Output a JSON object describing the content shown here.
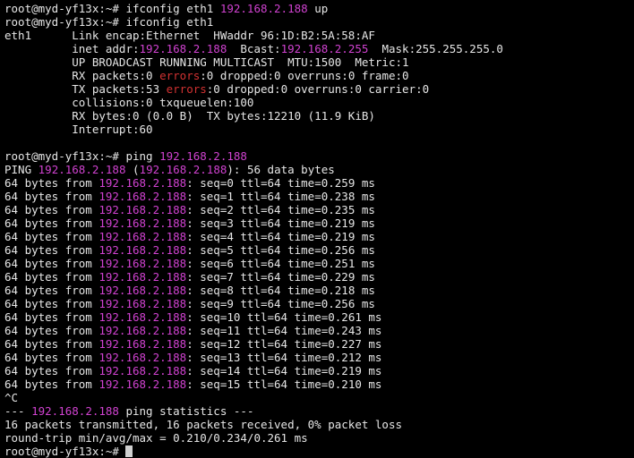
{
  "colors": {
    "background": "#000000",
    "text": "#e6e6e6",
    "ip_highlight": "#d042d0",
    "error_highlight": "#d23232"
  },
  "prompt": "root@myd-yf13x:~# ",
  "ip": "192.168.2.188",
  "lines": [
    [
      {
        "t": "root@myd-yf13x:~# ifconfig eth1 "
      },
      {
        "t": "192.168.2.188",
        "c": "mag"
      },
      {
        "t": " up"
      }
    ],
    [
      {
        "t": "root@myd-yf13x:~# ifconfig eth1"
      }
    ],
    [
      {
        "t": "eth1      Link encap:Ethernet  HWaddr 96:1D:B2:5A:58:AF"
      }
    ],
    [
      {
        "t": "          inet addr:"
      },
      {
        "t": "192.168.2.188",
        "c": "mag"
      },
      {
        "t": "  Bcast:"
      },
      {
        "t": "192.168.2.255",
        "c": "mag"
      },
      {
        "t": "  Mask:255.255.255.0"
      }
    ],
    [
      {
        "t": "          UP BROADCAST RUNNING MULTICAST  MTU:1500  Metric:1"
      }
    ],
    [
      {
        "t": "          RX packets:0 "
      },
      {
        "t": "errors",
        "c": "red"
      },
      {
        "t": ":0 dropped:0 overruns:0 frame:0"
      }
    ],
    [
      {
        "t": "          TX packets:53 "
      },
      {
        "t": "errors",
        "c": "red"
      },
      {
        "t": ":0 dropped:0 overruns:0 carrier:0"
      }
    ],
    [
      {
        "t": "          collisions:0 txqueuelen:100"
      }
    ],
    [
      {
        "t": "          RX bytes:0 (0.0 B)  TX bytes:12210 (11.9 KiB)"
      }
    ],
    [
      {
        "t": "          Interrupt:60"
      }
    ],
    [
      {
        "t": ""
      }
    ],
    [
      {
        "t": "root@myd-yf13x:~# ping "
      },
      {
        "t": "192.168.2.188",
        "c": "mag"
      }
    ],
    [
      {
        "t": "PING "
      },
      {
        "t": "192.168.2.188",
        "c": "mag"
      },
      {
        "t": " ("
      },
      {
        "t": "192.168.2.188",
        "c": "mag"
      },
      {
        "t": "): 56 data bytes"
      }
    ],
    [
      {
        "t": "64 bytes from "
      },
      {
        "t": "192.168.2.188",
        "c": "mag"
      },
      {
        "t": ": seq=0 ttl=64 time=0.259 ms"
      }
    ],
    [
      {
        "t": "64 bytes from "
      },
      {
        "t": "192.168.2.188",
        "c": "mag"
      },
      {
        "t": ": seq=1 ttl=64 time=0.238 ms"
      }
    ],
    [
      {
        "t": "64 bytes from "
      },
      {
        "t": "192.168.2.188",
        "c": "mag"
      },
      {
        "t": ": seq=2 ttl=64 time=0.235 ms"
      }
    ],
    [
      {
        "t": "64 bytes from "
      },
      {
        "t": "192.168.2.188",
        "c": "mag"
      },
      {
        "t": ": seq=3 ttl=64 time=0.219 ms"
      }
    ],
    [
      {
        "t": "64 bytes from "
      },
      {
        "t": "192.168.2.188",
        "c": "mag"
      },
      {
        "t": ": seq=4 ttl=64 time=0.219 ms"
      }
    ],
    [
      {
        "t": "64 bytes from "
      },
      {
        "t": "192.168.2.188",
        "c": "mag"
      },
      {
        "t": ": seq=5 ttl=64 time=0.256 ms"
      }
    ],
    [
      {
        "t": "64 bytes from "
      },
      {
        "t": "192.168.2.188",
        "c": "mag"
      },
      {
        "t": ": seq=6 ttl=64 time=0.251 ms"
      }
    ],
    [
      {
        "t": "64 bytes from "
      },
      {
        "t": "192.168.2.188",
        "c": "mag"
      },
      {
        "t": ": seq=7 ttl=64 time=0.229 ms"
      }
    ],
    [
      {
        "t": "64 bytes from "
      },
      {
        "t": "192.168.2.188",
        "c": "mag"
      },
      {
        "t": ": seq=8 ttl=64 time=0.218 ms"
      }
    ],
    [
      {
        "t": "64 bytes from "
      },
      {
        "t": "192.168.2.188",
        "c": "mag"
      },
      {
        "t": ": seq=9 ttl=64 time=0.256 ms"
      }
    ],
    [
      {
        "t": "64 bytes from "
      },
      {
        "t": "192.168.2.188",
        "c": "mag"
      },
      {
        "t": ": seq=10 ttl=64 time=0.261 ms"
      }
    ],
    [
      {
        "t": "64 bytes from "
      },
      {
        "t": "192.168.2.188",
        "c": "mag"
      },
      {
        "t": ": seq=11 ttl=64 time=0.243 ms"
      }
    ],
    [
      {
        "t": "64 bytes from "
      },
      {
        "t": "192.168.2.188",
        "c": "mag"
      },
      {
        "t": ": seq=12 ttl=64 time=0.227 ms"
      }
    ],
    [
      {
        "t": "64 bytes from "
      },
      {
        "t": "192.168.2.188",
        "c": "mag"
      },
      {
        "t": ": seq=13 ttl=64 time=0.212 ms"
      }
    ],
    [
      {
        "t": "64 bytes from "
      },
      {
        "t": "192.168.2.188",
        "c": "mag"
      },
      {
        "t": ": seq=14 ttl=64 time=0.219 ms"
      }
    ],
    [
      {
        "t": "64 bytes from "
      },
      {
        "t": "192.168.2.188",
        "c": "mag"
      },
      {
        "t": ": seq=15 ttl=64 time=0.210 ms"
      }
    ],
    [
      {
        "t": "^C"
      }
    ],
    [
      {
        "t": "--- "
      },
      {
        "t": "192.168.2.188",
        "c": "mag"
      },
      {
        "t": " ping statistics ---"
      }
    ],
    [
      {
        "t": "16 packets transmitted, 16 packets received, 0% packet loss"
      }
    ],
    [
      {
        "t": "round-trip min/avg/max = 0.210/0.234/0.261 ms"
      }
    ]
  ]
}
